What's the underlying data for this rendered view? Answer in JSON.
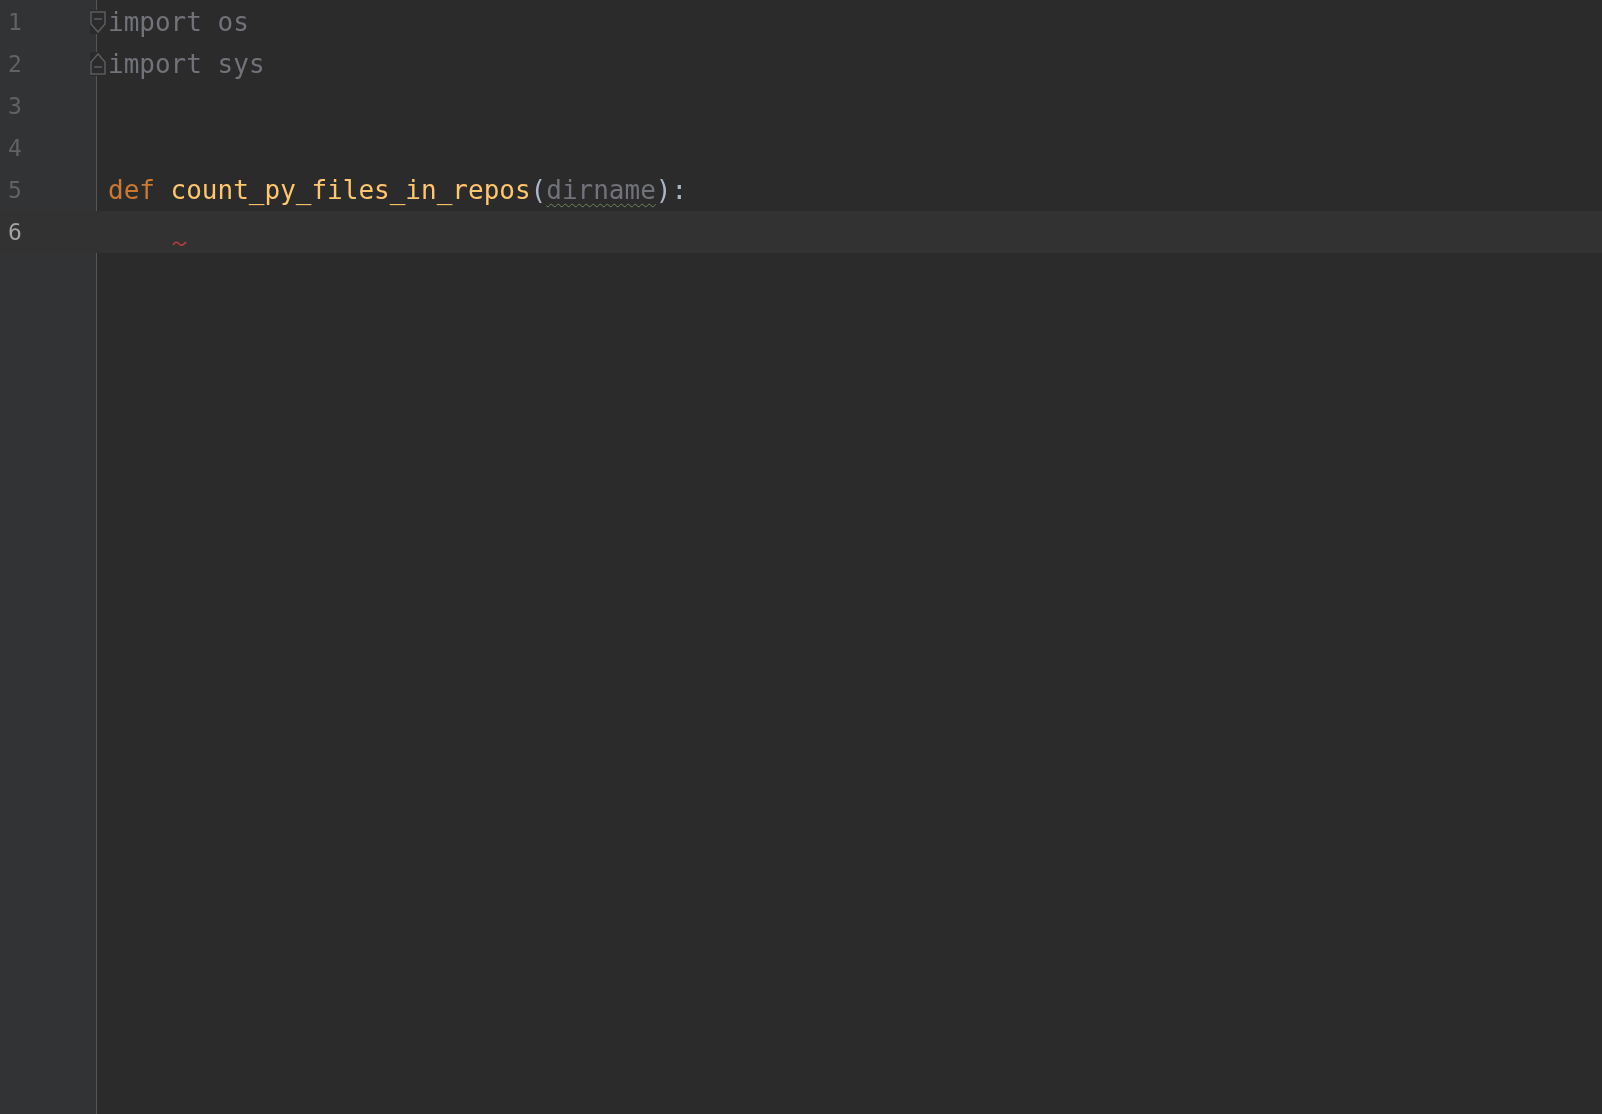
{
  "editor": {
    "lines": [
      {
        "number": "1",
        "current": false,
        "fold_start": true,
        "tokens": [
          {
            "text": "import os",
            "kind": "unused",
            "warning": false
          }
        ]
      },
      {
        "number": "2",
        "current": false,
        "fold_end": true,
        "tokens": [
          {
            "text": "import sys",
            "kind": "unused",
            "warning": false
          }
        ]
      },
      {
        "number": "3",
        "current": false
      },
      {
        "number": "4",
        "current": false
      },
      {
        "number": "5",
        "current": false,
        "tokens": [
          {
            "text": "def",
            "kind": "keyword",
            "warning": false
          },
          {
            "text": "count_py_files_in_repos",
            "kind": "function",
            "warning": false
          },
          {
            "text": "(",
            "kind": "plain",
            "warning": false
          },
          {
            "text": "dirname",
            "kind": "unused",
            "warning": true
          },
          {
            "text": "):",
            "kind": "plain",
            "warning": false
          }
        ]
      },
      {
        "number": "6",
        "current": true,
        "indent_error": true
      }
    ]
  }
}
